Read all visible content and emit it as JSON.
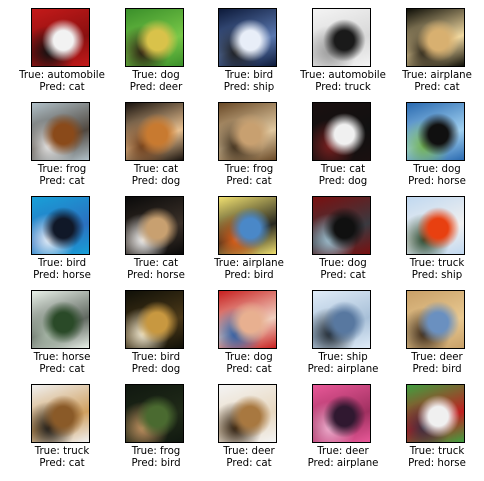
{
  "samples": [
    {
      "true_label": "True: automobile",
      "pred_label": "Pred: cat",
      "colors": [
        "#c41a1a",
        "#f2f2f2",
        "#111111",
        "#8a0f0f"
      ]
    },
    {
      "true_label": "True: dog",
      "pred_label": "Pred: deer",
      "colors": [
        "#3a8f2a",
        "#d9c24a",
        "#2a1a10",
        "#78c848"
      ]
    },
    {
      "true_label": "True: bird",
      "pred_label": "Pred: ship",
      "colors": [
        "#0d1a3a",
        "#e8eef8",
        "#1c1c1c",
        "#5a78b0"
      ]
    },
    {
      "true_label": "True: automobile",
      "pred_label": "Pred: truck",
      "colors": [
        "#f4f4f4",
        "#1a1a1a",
        "#9a9a9a",
        "#d8d8d8"
      ]
    },
    {
      "true_label": "True: airplane",
      "pred_label": "Pred: cat",
      "colors": [
        "#0f0f08",
        "#d8b070",
        "#2a2418",
        "#f0d8a0"
      ]
    },
    {
      "true_label": "True: frog",
      "pred_label": "Pred: cat",
      "colors": [
        "#b0c0c8",
        "#8a4a1a",
        "#e8e8e8",
        "#504840"
      ]
    },
    {
      "true_label": "True: cat",
      "pred_label": "Pred: dog",
      "colors": [
        "#1a1410",
        "#c87a30",
        "#6a3a18",
        "#e8c090"
      ]
    },
    {
      "true_label": "True: frog",
      "pred_label": "Pred: cat",
      "colors": [
        "#6a4a28",
        "#c8a070",
        "#3a2a18",
        "#e0c8a0"
      ]
    },
    {
      "true_label": "True: cat",
      "pred_label": "Pred: dog",
      "colors": [
        "#1a1010",
        "#f0f0f0",
        "#7a2020",
        "#101010"
      ]
    },
    {
      "true_label": "True: dog",
      "pred_label": "Pred: horse",
      "colors": [
        "#2a6ab0",
        "#101010",
        "#70b050",
        "#a0d0f0"
      ]
    },
    {
      "true_label": "True: bird",
      "pred_label": "Pred: horse",
      "colors": [
        "#18a0d8",
        "#101828",
        "#e8f0f8",
        "#2a70c0"
      ]
    },
    {
      "true_label": "True: cat",
      "pred_label": "Pred: horse",
      "colors": [
        "#0a0a0a",
        "#c8a070",
        "#f0f0f0",
        "#3a3028"
      ]
    },
    {
      "true_label": "True: airplane",
      "pred_label": "Pred: bird",
      "colors": [
        "#f0e070",
        "#4a88c8",
        "#e06018",
        "#282820"
      ]
    },
    {
      "true_label": "True: dog",
      "pred_label": "Pred: cat",
      "colors": [
        "#7a1010",
        "#101010",
        "#a0c0d0",
        "#3a3a40"
      ]
    },
    {
      "true_label": "True: truck",
      "pred_label": "Pred: ship",
      "colors": [
        "#c0d8f0",
        "#e84010",
        "#2a4a30",
        "#f0f0f0"
      ]
    },
    {
      "true_label": "True: horse",
      "pred_label": "Pred: cat",
      "colors": [
        "#e8f0e8",
        "#2a4a28",
        "#a8b8a8",
        "#606860"
      ]
    },
    {
      "true_label": "True: bird",
      "pred_label": "Pred: dog",
      "colors": [
        "#101008",
        "#c89840",
        "#f0e8d0",
        "#4a3818"
      ]
    },
    {
      "true_label": "True: dog",
      "pred_label": "Pred: cat",
      "colors": [
        "#c82020",
        "#e8b090",
        "#2858a0",
        "#f0d0c0"
      ]
    },
    {
      "true_label": "True: ship",
      "pred_label": "Pred: airplane",
      "colors": [
        "#e0ecf8",
        "#5878a0",
        "#202830",
        "#a8c0d8"
      ]
    },
    {
      "true_label": "True: deer",
      "pred_label": "Pred: bird",
      "colors": [
        "#c8a068",
        "#6a90c0",
        "#3a2818",
        "#e8c890"
      ]
    },
    {
      "true_label": "True: truck",
      "pred_label": "Pred: cat",
      "colors": [
        "#f0f0f0",
        "#8a5a28",
        "#1a1a1a",
        "#d0a060"
      ]
    },
    {
      "true_label": "True: frog",
      "pred_label": "Pred: bird",
      "colors": [
        "#101810",
        "#4a6a30",
        "#c09060",
        "#202a18"
      ]
    },
    {
      "true_label": "True: deer",
      "pred_label": "Pred: cat",
      "colors": [
        "#f4f4f4",
        "#a87840",
        "#2a1a0a",
        "#e8d8c0"
      ]
    },
    {
      "true_label": "True: deer",
      "pred_label": "Pred: airplane",
      "colors": [
        "#e85898",
        "#301830",
        "#f0b0d0",
        "#a03060"
      ]
    },
    {
      "true_label": "True: truck",
      "pred_label": "Pred: horse",
      "colors": [
        "#40a040",
        "#f0f0f0",
        "#3a3040",
        "#c02020"
      ]
    }
  ]
}
